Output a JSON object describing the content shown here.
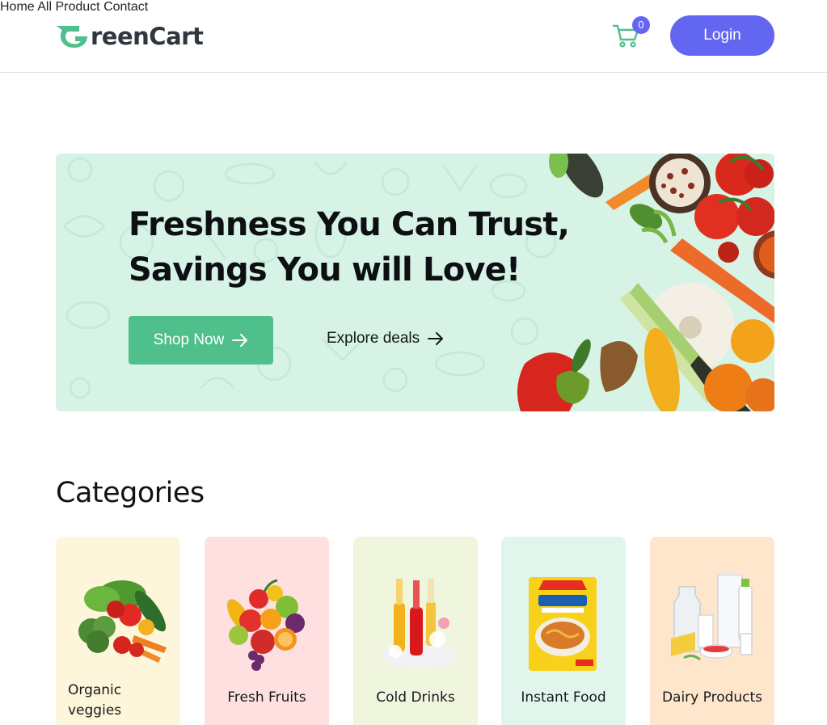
{
  "header": {
    "logo_text": "reenCart",
    "nav": [
      {
        "label": "Home"
      },
      {
        "label": "All Product"
      },
      {
        "label": "Contact"
      }
    ],
    "cart_count": "0",
    "login_label": "Login"
  },
  "hero": {
    "title_line1": "Freshness You Can Trust,",
    "title_line2": "Savings You will Love!",
    "shop_now": "Shop Now",
    "explore": "Explore deals"
  },
  "categories": {
    "heading": "Categories",
    "items": [
      {
        "label": "Organic veggies",
        "bg": "#fef6da"
      },
      {
        "label": "Fresh Fruits",
        "bg": "#fee0e0"
      },
      {
        "label": "Cold Drinks",
        "bg": "#f0f5de"
      },
      {
        "label": "Instant Food",
        "bg": "#e1f5ec"
      },
      {
        "label": "Dairy Products",
        "bg": "#fee6cd"
      }
    ]
  },
  "colors": {
    "accent": "#6366f1",
    "primary_green": "#4fbf8b",
    "hero_bg": "#d6f3e6"
  }
}
